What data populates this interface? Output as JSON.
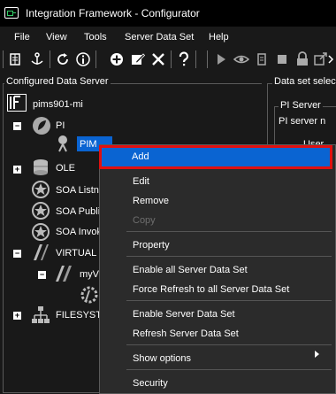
{
  "window": {
    "title": "Integration Framework - Configurator"
  },
  "menubar": {
    "items": [
      "File",
      "View",
      "Tools",
      "Server Data Set",
      "Help"
    ]
  },
  "toolbar": {
    "icons": [
      "grip-icon",
      "document-icon",
      "anchor-icon",
      "refresh-icon",
      "info-icon",
      "add-icon",
      "edit-icon",
      "delete-icon",
      "help-icon",
      "grip-icon",
      "play-icon",
      "eye-icon",
      "script-icon",
      "stop-icon",
      "lock-icon",
      "export-icon",
      "chevron-right-icon"
    ]
  },
  "left_panel": {
    "title": "Configured Data Server",
    "server": "pims901-mi",
    "tree": {
      "pi": "PI",
      "pi_child": "PIM",
      "ole": "OLE",
      "soa_listener": "SOA Listne",
      "soa_publisher": "SOA Publi",
      "soa_invoker": "SOA Invok",
      "virtual": "VIRTUAL",
      "virtual_child": "myVi",
      "filesystem": "FILESYSTE"
    }
  },
  "right_panel": {
    "title": "Data set selec",
    "pi_server_group": "PI Server",
    "pi_server_note": "PI server n",
    "user_label": "User"
  },
  "context_menu": {
    "items": {
      "add": "Add",
      "edit": "Edit",
      "remove": "Remove",
      "copy": "Copy",
      "property": "Property",
      "enable_all": "Enable all Server Data Set",
      "force_refresh_all": "Force Refresh to all Server Data Set",
      "enable_server": "Enable Server Data Set",
      "refresh_server": "Refresh Server Data Set",
      "show_options": "Show options",
      "security": "Security"
    },
    "highlight_color": "#0a64d2",
    "callout_color": "#e01010"
  }
}
